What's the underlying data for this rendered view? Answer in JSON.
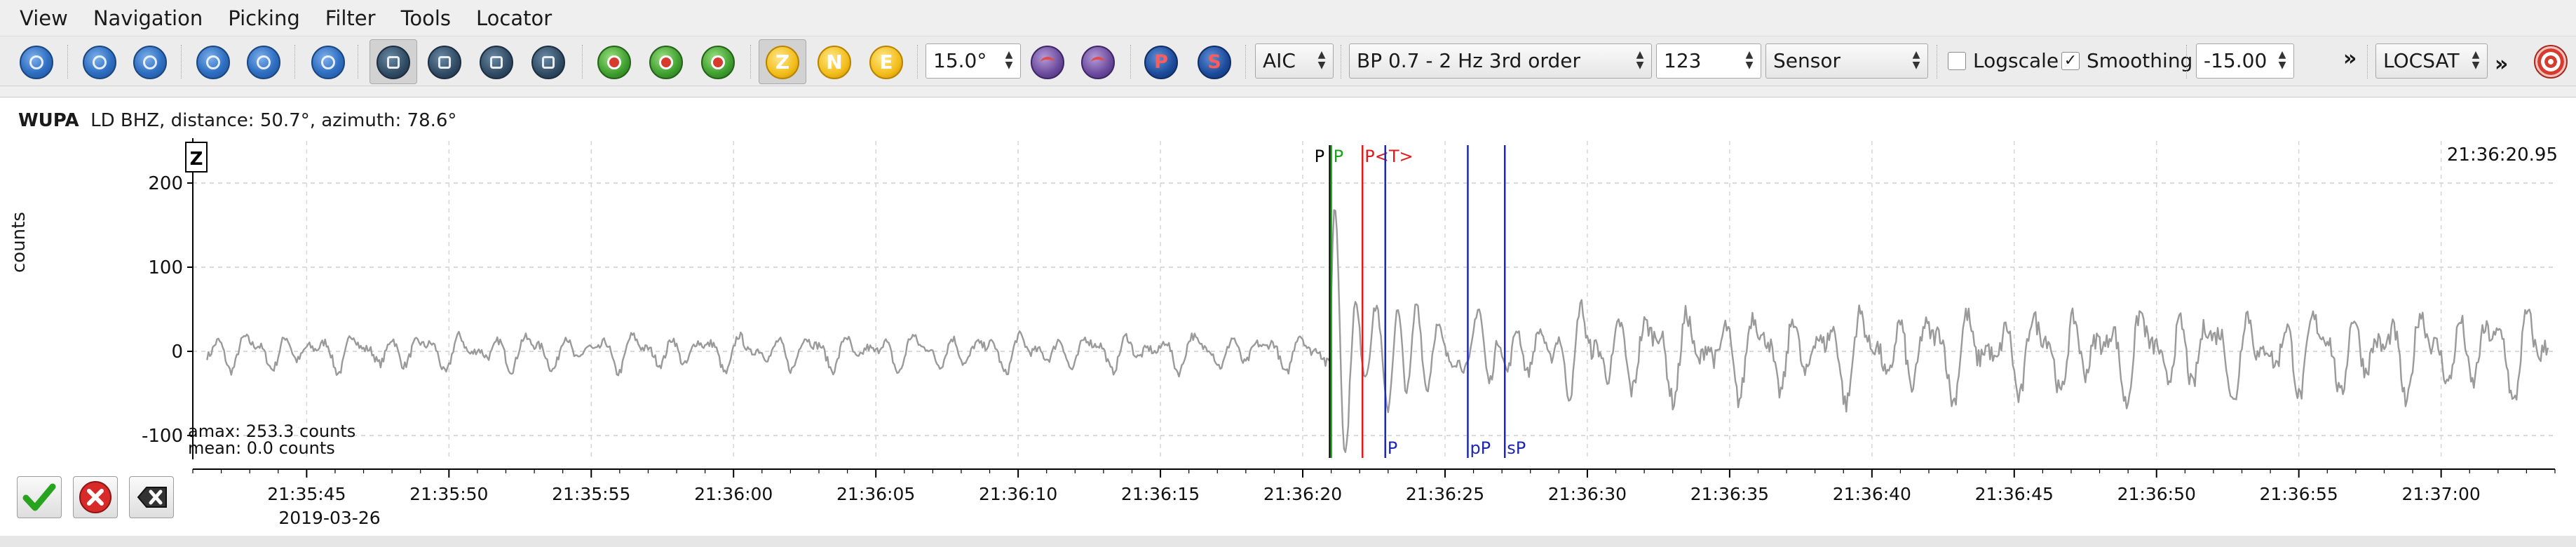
{
  "menubar": {
    "items": [
      "View",
      "Navigation",
      "Picking",
      "Filter",
      "Tools",
      "Locator"
    ]
  },
  "toolbar": {
    "nav_icons": [
      "home-icon",
      "scroll-up-icon",
      "scroll-down-icon",
      "scroll-left-icon",
      "scroll-right-icon",
      "align-icon"
    ],
    "tool_icons": [
      "measure-icon",
      "rotate-icon",
      "zoom-icon",
      "save-icon"
    ],
    "pick_icons": [
      "pick-add-icon",
      "pick-remove-icon",
      "pick-refresh-icon"
    ],
    "components": [
      "Z",
      "N",
      "E"
    ],
    "active_component": "Z",
    "distance_value": "15.0°",
    "filter_icons": [
      "filter-purple-icon",
      "filter-purple-2-icon"
    ],
    "phases": [
      "P",
      "S"
    ],
    "picker_method": "AIC",
    "filter_value": "BP 0.7 - 2 Hz  3rd order",
    "number_value": "123",
    "unit_value": "Sensor",
    "logscale_label": "Logscale",
    "logscale_checked": false,
    "smoothing_label": "Smoothing",
    "smoothing_checked": true,
    "offset_value": "-15.00",
    "overflow_label": "»",
    "locator_value": "LOCSAT",
    "overflow2_label": "»"
  },
  "trace": {
    "station": "WUPA",
    "header_rest": "LD  BHZ, distance: 50.7°, azimuth: 78.6°",
    "component_badge": "Z",
    "time_readout": "21:36:20.95",
    "ylabel": "counts",
    "amax": "amax: 253.3 counts",
    "mean": "mean: 0.0 counts",
    "date": "2019-03-26"
  },
  "chart_data": {
    "type": "line",
    "ylabel": "counts",
    "yticks": [
      200,
      100,
      0,
      -100
    ],
    "ylim": [
      -125,
      250
    ],
    "xlim": [
      "21:35:41",
      "21:37:04"
    ],
    "xticks": [
      "21:35:45",
      "21:35:50",
      "21:35:55",
      "21:36:00",
      "21:36:05",
      "21:36:10",
      "21:36:15",
      "21:36:20",
      "21:36:25",
      "21:36:30",
      "21:36:35",
      "21:36:40",
      "21:36:45",
      "21:36:50",
      "21:36:55",
      "21:37:00"
    ],
    "grid": true,
    "series_color": "#9a9a9a",
    "picks": [
      {
        "label": "P",
        "color": "#000000",
        "time": "21:36:20.95",
        "side": "top"
      },
      {
        "label": "P",
        "color": "#1aa31a",
        "time": "21:36:21.0",
        "side": "top"
      },
      {
        "label": "P<T>",
        "color": "#e01b1b",
        "time": "21:36:22.1",
        "side": "top"
      },
      {
        "label": "P",
        "color": "#1c27b5",
        "time": "21:36:22.9",
        "side": "bottom"
      },
      {
        "label": "pP",
        "color": "#1c27b5",
        "time": "21:36:25.8",
        "side": "bottom"
      },
      {
        "label": "sP",
        "color": "#1c27b5",
        "time": "21:36:27.1",
        "side": "bottom"
      }
    ]
  }
}
